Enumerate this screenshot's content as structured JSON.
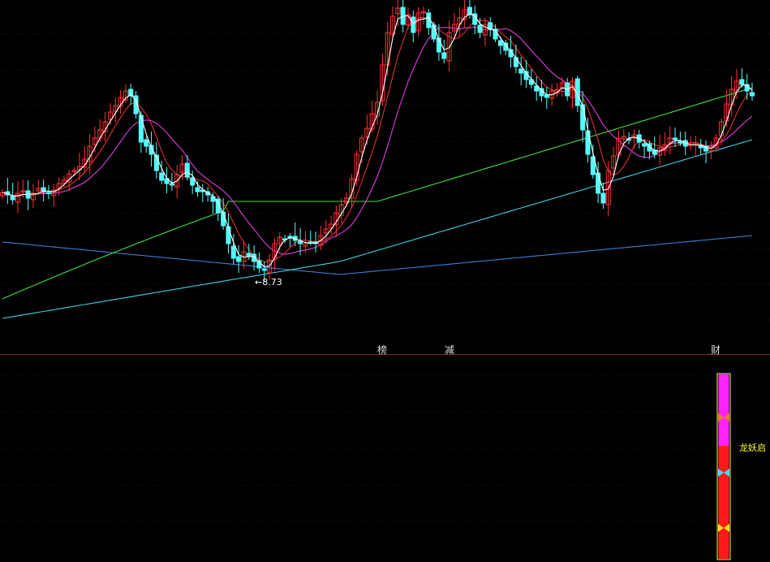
{
  "chart_data": {
    "type": "candlestick",
    "main_panel": {
      "low_annotation": "←8.73",
      "low_value": 8.73,
      "ma_colors": {
        "ma5": "#ffffff",
        "ma10": "#e03030",
        "ma20": "#e040e0",
        "ma60": "#40e040",
        "ma120": "#40d0e0",
        "ma250": "#3a7fd8"
      },
      "up_color": "#ff3333",
      "down_color": "#54ffff",
      "markers": [
        {
          "text": "榜",
          "color": "#e0a020"
        },
        {
          "text": "减",
          "color": "#40e040"
        },
        {
          "text": "财",
          "color": "#5aa0ff"
        }
      ]
    },
    "sub_panel": {
      "label": "龙妖启",
      "label_color": "#ffff33",
      "bar_colors": {
        "top": "#ff22ff",
        "bottom": "#ff1a1a",
        "border": "#ffff33"
      },
      "butterfly_colors": [
        "#e08020",
        "#40e0f0",
        "#ffe020"
      ]
    }
  }
}
